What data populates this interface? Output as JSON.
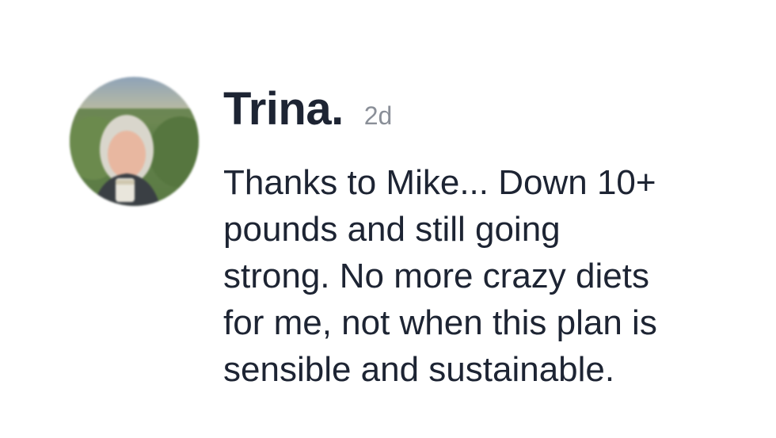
{
  "comment": {
    "author": "Trina.",
    "time_ago": "2d",
    "text": "Thanks to Mike... Down 10+\npounds and still going\nstrong.  No more crazy diets\nfor me, not when this plan is\nsensible and sustainable."
  },
  "colors": {
    "text_primary": "#1d2433",
    "text_secondary": "#8a8f98",
    "background": "#ffffff"
  }
}
